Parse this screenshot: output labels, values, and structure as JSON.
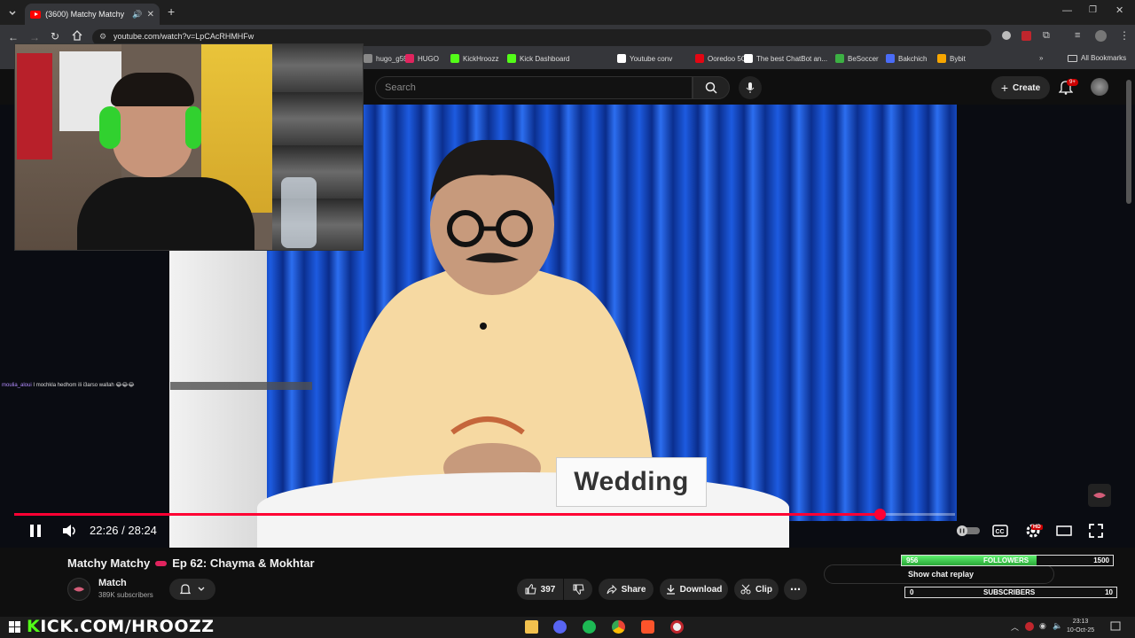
{
  "browser": {
    "tab_title": "(3600) Matchy Matchy",
    "url": "youtube.com/watch?v=LpCAcRHMHFw",
    "bookmarks": [
      {
        "label": "hugo_g59",
        "color": "#888888"
      },
      {
        "label": "HUGO",
        "color": "#e0245e"
      },
      {
        "label": "KickHroozz",
        "color": "#53fc18"
      },
      {
        "label": "Kick Dashboard",
        "color": "#53fc18"
      },
      {
        "label": "Youtube conv",
        "color": "#ffffff"
      },
      {
        "label": "Ooredoo 5G",
        "color": "#e30613"
      },
      {
        "label": "The best ChatBot an...",
        "color": "#ffffff"
      },
      {
        "label": "BeSoccer",
        "color": "#3cb043"
      },
      {
        "label": "Bakchich",
        "color": "#4a6cf7"
      },
      {
        "label": "Bybit",
        "color": "#f7a600"
      }
    ],
    "all_bookmarks": "All Bookmarks"
  },
  "youtube": {
    "search_placeholder": "Search",
    "create_label": "Create",
    "notification_badge": "9+"
  },
  "video": {
    "nameplate": "Wedding",
    "time_current": "22:26",
    "time_total": "28:24",
    "time_display": "22:26 / 28:24",
    "progress": 0.92,
    "title": "Matchy Matchy",
    "title_suffix": "Ep 62: Chayma & Mokhtar",
    "channel": "Match",
    "subscribers": "389K subscribers",
    "likes": "397",
    "share_label": "Share",
    "download_label": "Download",
    "clip_label": "Clip",
    "hd_badge": "HD",
    "chat_overlay_user": "moulia_aloui",
    "chat_overlay_text": "I mochkla hedhom ili i3arso wallah 😂😂😂"
  },
  "chat": {
    "show_replay": "Show chat replay"
  },
  "stream_overlay": {
    "followers_current": "956",
    "followers_label": "FOLLOWERS",
    "followers_goal": "1500",
    "followers_fraction": 0.64,
    "subs_current": "0",
    "subs_label": "SUBSCRIBERS",
    "subs_goal": "10",
    "kick_banner_k": "K",
    "kick_banner": "ICK.COM/HROOZZ"
  },
  "taskbar": {
    "time": "23:13",
    "date": "10-Oct-25"
  },
  "colors": {
    "accent_red": "#ff0033",
    "kick_green": "#53fc18"
  }
}
